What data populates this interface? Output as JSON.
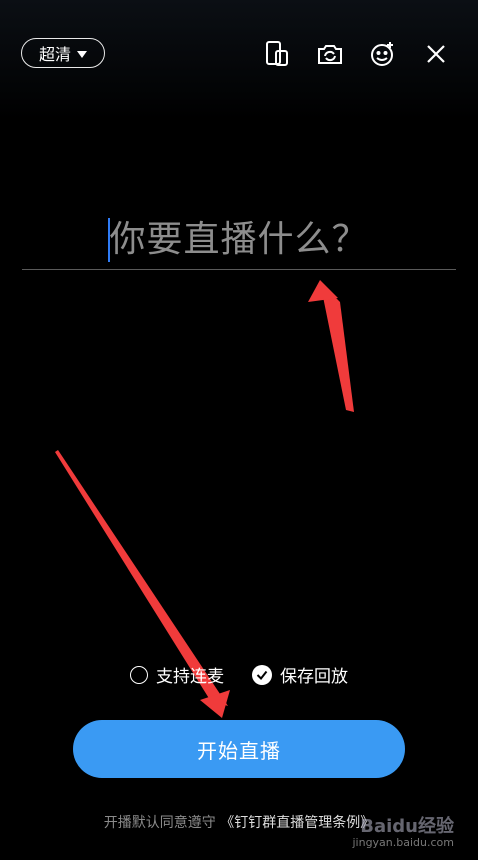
{
  "top_bar": {
    "quality_label": "超清",
    "icons": [
      "flip-screen-icon",
      "switch-camera-icon",
      "beauty-icon",
      "close-icon"
    ]
  },
  "prompt": {
    "placeholder": "你要直播什么？"
  },
  "options": {
    "co_host_label": "支持连麦",
    "co_host_checked": false,
    "save_replay_label": "保存回放",
    "save_replay_checked": true
  },
  "start_button": {
    "label": "开始直播"
  },
  "footer": {
    "agreement_prefix": "开播默认同意遵守",
    "agreement_link": "《钉钉群直播管理条例》"
  },
  "watermark": {
    "text": "Baidu经验",
    "sub": "jingyan.baidu.com"
  },
  "colors": {
    "accent": "#3a9af3",
    "cursor": "#2f7cf6",
    "arrow": "#f03b3b"
  }
}
